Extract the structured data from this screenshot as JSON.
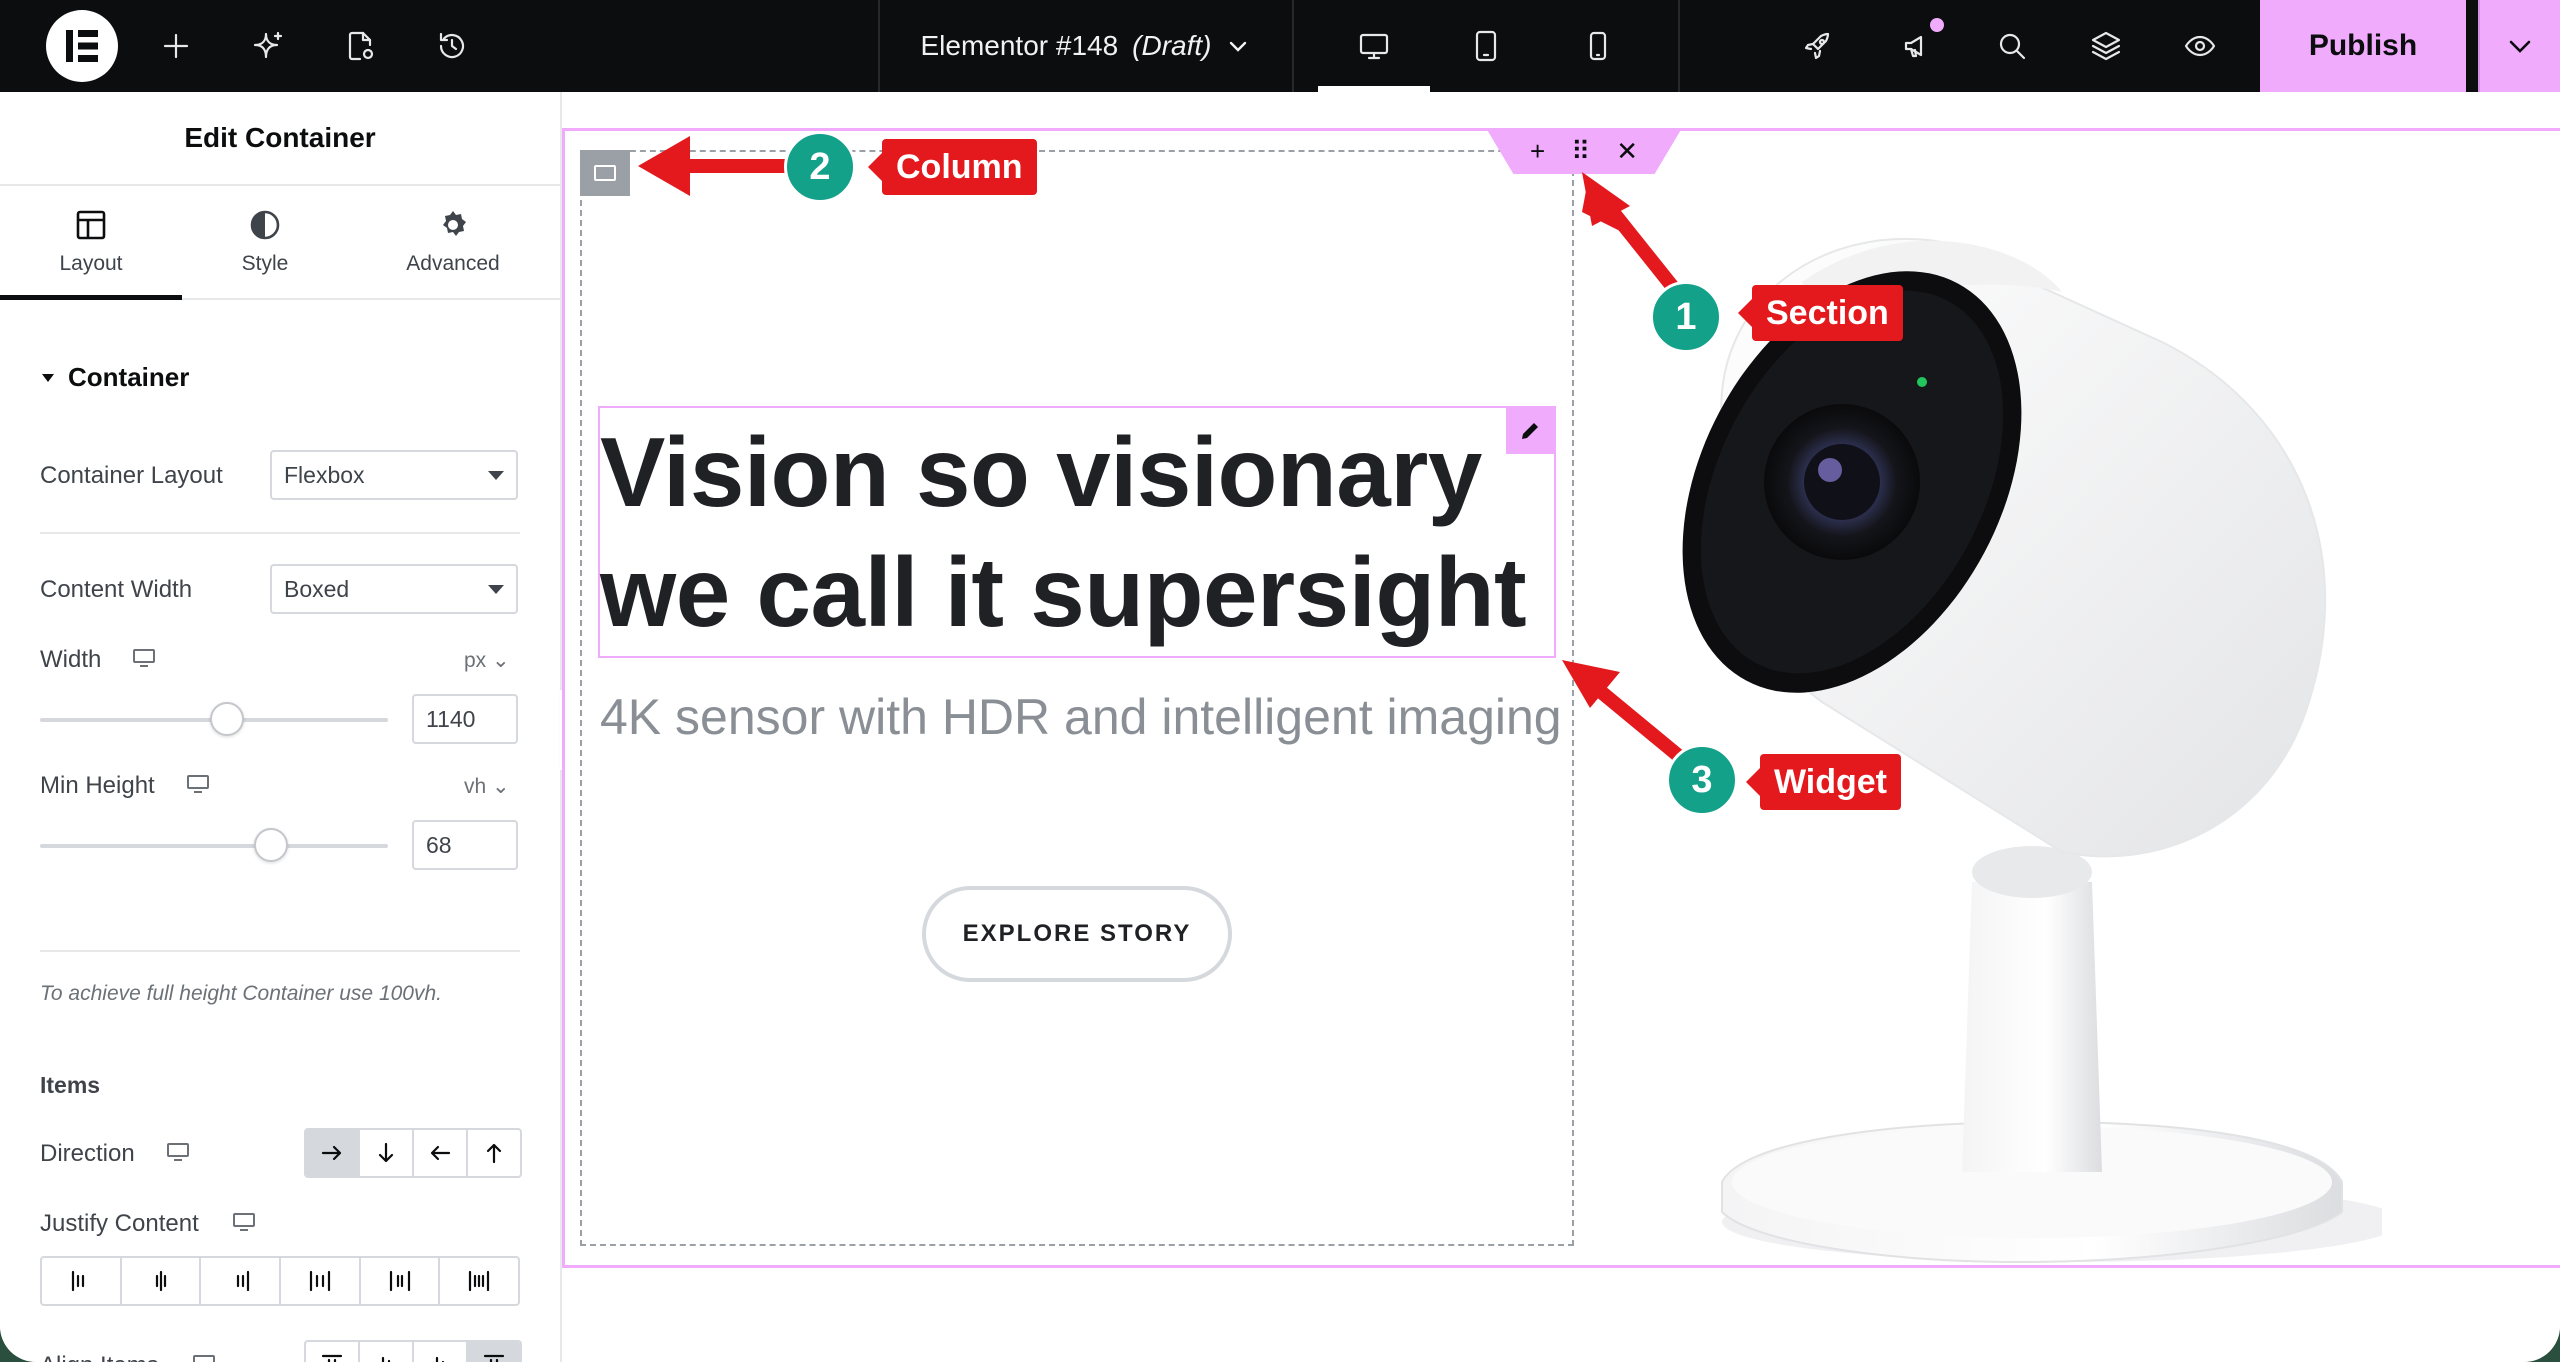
{
  "topbar": {
    "document_name": "Elementor #148",
    "document_status": "(Draft)",
    "publish_label": "Publish",
    "icons": [
      "elementor-logo-icon",
      "add-element-icon",
      "ai-sparkle-icon",
      "page-settings-icon",
      "history-icon",
      "desktop-icon",
      "tablet-icon",
      "mobile-icon",
      "rocket-icon",
      "announcements-icon",
      "search-icon",
      "structure-icon",
      "preview-icon",
      "chevron-down-icon"
    ]
  },
  "panel": {
    "title": "Edit Container",
    "tabs": [
      {
        "label": "Layout",
        "icon": "layout-icon"
      },
      {
        "label": "Style",
        "icon": "style-icon"
      },
      {
        "label": "Advanced",
        "icon": "gear-icon"
      }
    ],
    "section_title": "Container",
    "container_layout": {
      "label": "Container Layout",
      "value": "Flexbox"
    },
    "content_width": {
      "label": "Content Width",
      "value": "Boxed"
    },
    "width": {
      "label": "Width",
      "unit": "px",
      "value": "1140",
      "slider_fraction": 0.54
    },
    "min_height": {
      "label": "Min Height",
      "unit": "vh",
      "value": "68",
      "slider_fraction": 0.68
    },
    "hint": "To achieve full height Container use 100vh.",
    "items_title": "Items",
    "direction_label": "Direction",
    "justify_label": "Justify Content",
    "align_label": "Align Items"
  },
  "canvas": {
    "headline": "Vision so visionary we call it supersight",
    "subheadline": "4K sensor with HDR and intelligent imaging",
    "cta_label": "EXPLORE STORY"
  },
  "annotations": [
    {
      "number": "1",
      "label": "Section"
    },
    {
      "number": "2",
      "label": "Column"
    },
    {
      "number": "3",
      "label": "Widget"
    }
  ],
  "colors": {
    "accent": "#f0abfc",
    "annotation_red": "#e4191d",
    "annotation_teal": "#13a18a",
    "topbar_bg": "#0c0d0e"
  }
}
